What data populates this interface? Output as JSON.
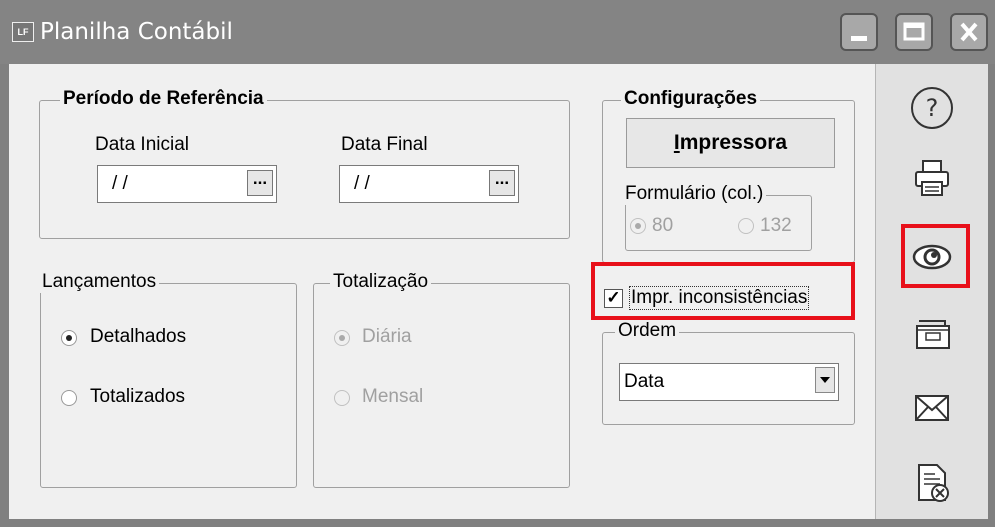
{
  "window": {
    "title": "Planilha Contábil",
    "app_icon_text": "LF"
  },
  "periodo": {
    "title": "Período de Referência",
    "data_inicial_label": "Data Inicial",
    "data_inicial_value": "/ /",
    "data_final_label": "Data Final",
    "data_final_value": "/ /",
    "ellipsis": "..."
  },
  "configuracoes": {
    "title": "Configurações",
    "impressora_button": "Impressora",
    "formulario": {
      "title": "Formulário (col.)",
      "opt80": "80",
      "opt132": "132",
      "selected": "80"
    }
  },
  "lancamentos": {
    "title": "Lançamentos",
    "detalhados": "Detalhados",
    "totalizados": "Totalizados",
    "selected": "Detalhados"
  },
  "totalizacao": {
    "title": "Totalização",
    "diaria": "Diária",
    "mensal": "Mensal",
    "selected": "Diária"
  },
  "impr_inconsistencias": {
    "label": "Impr. inconsistências",
    "checked": true
  },
  "ordem": {
    "title": "Ordem",
    "selected": "Data"
  },
  "sidebar": {
    "items": [
      {
        "name": "help-icon"
      },
      {
        "name": "printer-icon"
      },
      {
        "name": "preview-eye-icon"
      },
      {
        "name": "folder-icon"
      },
      {
        "name": "email-icon"
      },
      {
        "name": "cancel-document-icon"
      }
    ]
  },
  "colors": {
    "highlight": "#e8101a",
    "titlebar": "#848484",
    "client_bg": "#f0f0f0"
  }
}
